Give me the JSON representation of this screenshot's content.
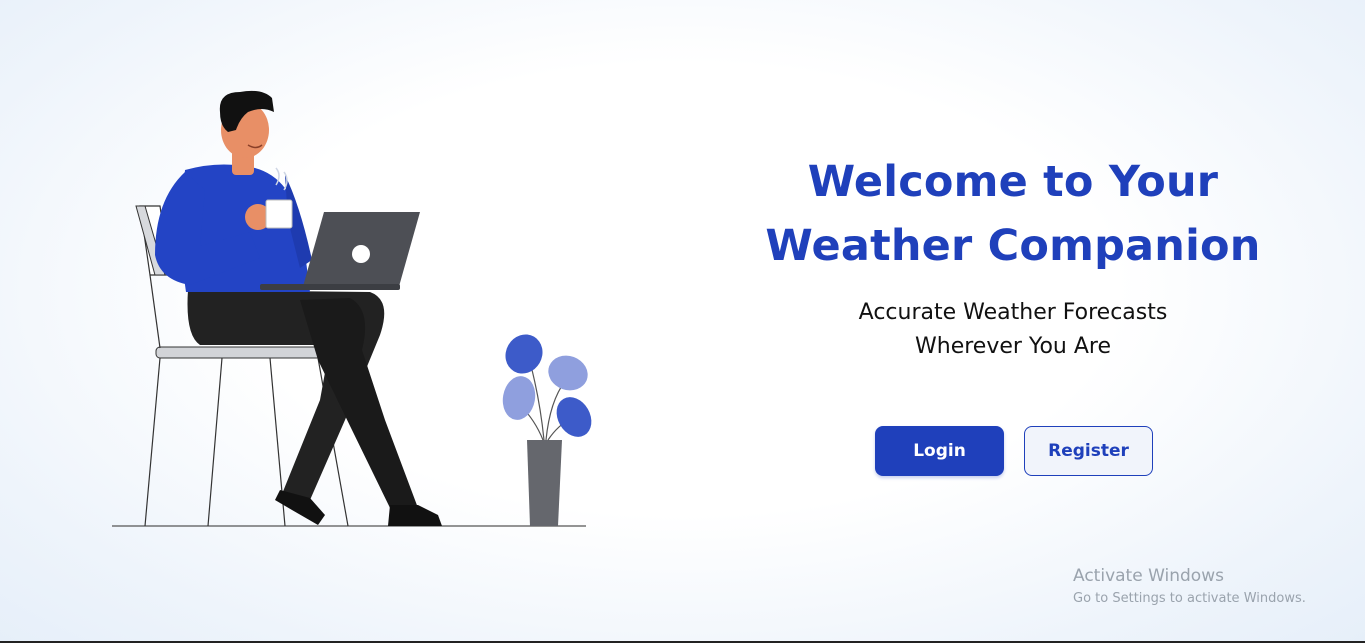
{
  "hero": {
    "title_line1": "Welcome to Your",
    "title_line2": "Weather Companion",
    "subtitle_line1": "Accurate Weather Forecasts",
    "subtitle_line2": "Wherever You Are"
  },
  "actions": {
    "login_label": "Login",
    "register_label": "Register"
  },
  "watermark": {
    "title": "Activate Windows",
    "subtitle": "Go to Settings to activate Windows."
  },
  "illustration": {
    "icon": "person-with-laptop-illustration"
  },
  "colors": {
    "brand": "#1f40bb",
    "text": "#111111",
    "watermark": "#9aa3ad"
  }
}
